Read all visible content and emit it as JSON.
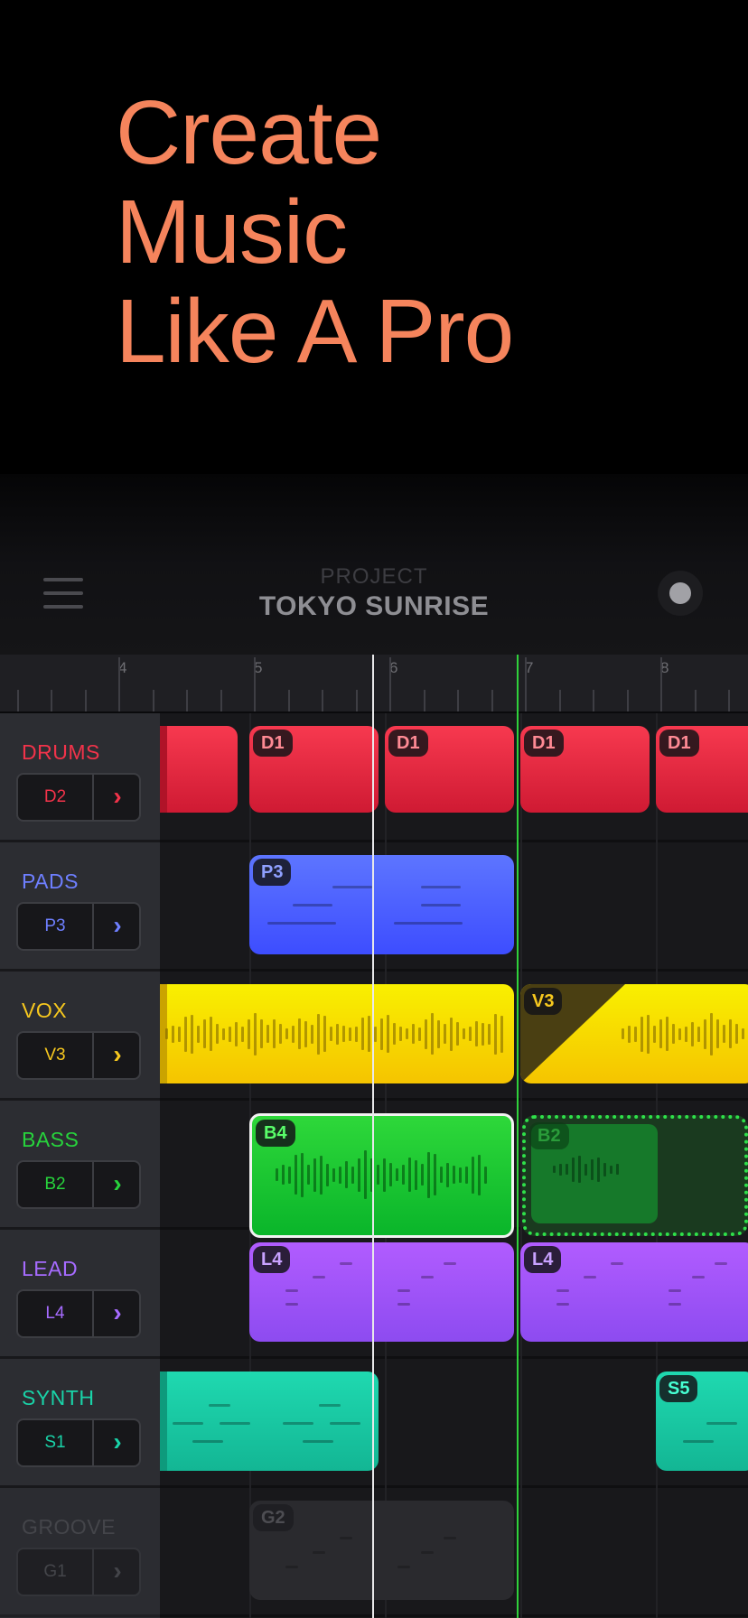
{
  "hero": {
    "lines": [
      "Create",
      "Music",
      "Like A Pro"
    ]
  },
  "header": {
    "kicker": "PROJECT",
    "project_name": "TOKYO SUNRISE",
    "menu_icon": "hamburger-menu-icon",
    "record_icon": "record-icon"
  },
  "ruler": {
    "bars": [
      "4",
      "5",
      "6",
      "7",
      "8"
    ]
  },
  "tracks": [
    {
      "name": "DRUMS",
      "code": "D2",
      "color": "#f2334a"
    },
    {
      "name": "PADS",
      "code": "P3",
      "color": "#6e7fff"
    },
    {
      "name": "VOX",
      "code": "V3",
      "color": "#f7c81e"
    },
    {
      "name": "BASS",
      "code": "B2",
      "color": "#27d33c"
    },
    {
      "name": "LEAD",
      "code": "L4",
      "color": "#a66bff"
    },
    {
      "name": "SYNTH",
      "code": "S1",
      "color": "#19d3a8"
    },
    {
      "name": "GROOVE",
      "code": "G1",
      "color": "#4a4b50"
    }
  ],
  "clips": [
    {
      "track": 0,
      "label": "D1"
    },
    {
      "track": 0,
      "label": "D1"
    },
    {
      "track": 0,
      "label": "D1"
    },
    {
      "track": 0,
      "label": "D1"
    },
    {
      "track": 1,
      "label": "P3"
    },
    {
      "track": 2,
      "label": "V3"
    },
    {
      "track": 3,
      "label": "B4"
    },
    {
      "track": 3,
      "label": "B2"
    },
    {
      "track": 4,
      "label": "L4"
    },
    {
      "track": 4,
      "label": "L4"
    },
    {
      "track": 5,
      "label": "S5"
    },
    {
      "track": 6,
      "label": "G2"
    }
  ]
}
